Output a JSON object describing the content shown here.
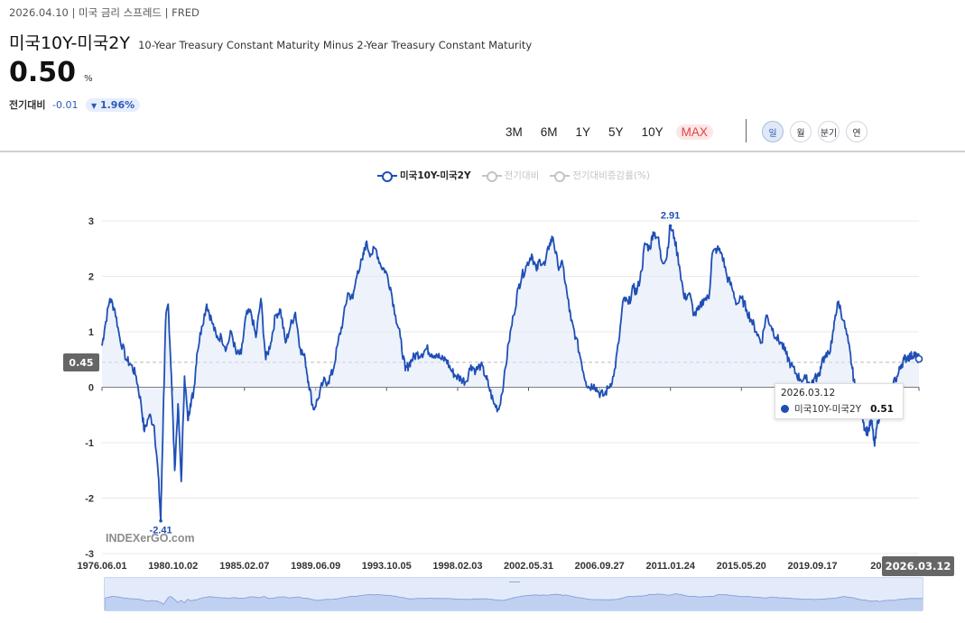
{
  "header": {
    "meta": "2026.04.10 | 미국 금리 스프레드 | FRED",
    "title": "미국10Y-미국2Y",
    "subtitle": "10-Year Treasury Constant Maturity Minus 2-Year Treasury Constant Maturity",
    "value": "0.50",
    "unit": "%",
    "change_label": "전기대비",
    "change_value": "-0.01",
    "change_pct": "1.96%"
  },
  "ranges": [
    "3M",
    "6M",
    "1Y",
    "5Y",
    "10Y",
    "MAX"
  ],
  "active_range": "MAX",
  "periods": [
    "일",
    "월",
    "분기",
    "연"
  ],
  "active_period": "일",
  "legend": [
    {
      "label": "미국10Y-미국2Y",
      "active": true
    },
    {
      "label": "전기대비",
      "active": false
    },
    {
      "label": "전기대비증감률(%)",
      "active": false
    }
  ],
  "watermark": "INDEXerGO.com",
  "tooltip": {
    "date": "2026.03.12",
    "series": "미국10Y-미국2Y",
    "value": "0.51"
  },
  "y_flag": "0.45",
  "x_flag": "2026.03.12",
  "colors": {
    "line": "#1f4fb5",
    "fill": "#dfe8f7",
    "grid": "#e8e8e8"
  },
  "chart_data": {
    "type": "area",
    "title": "",
    "xlabel": "",
    "ylabel": "",
    "ylim": [
      -3,
      3
    ],
    "yticks": [
      3,
      2,
      1,
      0,
      -1,
      -2,
      -3
    ],
    "xlim": [
      1976.42,
      2026.2
    ],
    "xtick_labels": [
      "1976.06.01",
      "1980.10.02",
      "1985.02.07",
      "1989.06.09",
      "1993.10.05",
      "1998.02.03",
      "2002.05.31",
      "2006.09.27",
      "2011.01.24",
      "2015.05.20",
      "2019.09.17",
      "2024.",
      "2026.03.12"
    ],
    "xtick_positions": [
      1976.42,
      1980.75,
      1985.1,
      1989.44,
      1993.76,
      1998.09,
      2002.41,
      2006.74,
      2011.06,
      2015.38,
      2019.71,
      2024.0,
      2026.2
    ],
    "annotations": [
      {
        "label": "2.91",
        "x": 2011.05,
        "y": 2.91
      },
      {
        "label": "-2.41",
        "x": 1980.0,
        "y": -2.41
      }
    ],
    "reference_line": 0.45,
    "series": [
      {
        "name": "미국10Y-미국2Y",
        "points": [
          [
            1976.42,
            0.75
          ],
          [
            1976.6,
            1.1
          ],
          [
            1976.9,
            1.6
          ],
          [
            1977.2,
            1.4
          ],
          [
            1977.5,
            0.9
          ],
          [
            1977.9,
            0.5
          ],
          [
            1978.2,
            0.4
          ],
          [
            1978.5,
            0.2
          ],
          [
            1978.8,
            -0.3
          ],
          [
            1979.0,
            -0.8
          ],
          [
            1979.3,
            -0.5
          ],
          [
            1979.6,
            -0.7
          ],
          [
            1979.85,
            -1.6
          ],
          [
            1980.0,
            -2.41
          ],
          [
            1980.15,
            -0.5
          ],
          [
            1980.3,
            1.2
          ],
          [
            1980.45,
            1.5
          ],
          [
            1980.65,
            0.2
          ],
          [
            1980.85,
            -1.5
          ],
          [
            1981.05,
            -0.3
          ],
          [
            1981.25,
            -1.7
          ],
          [
            1981.45,
            0.2
          ],
          [
            1981.65,
            -0.6
          ],
          [
            1981.8,
            -0.3
          ],
          [
            1982.0,
            -0.1
          ],
          [
            1982.2,
            0.6
          ],
          [
            1982.5,
            1.1
          ],
          [
            1982.8,
            1.5
          ],
          [
            1983.1,
            1.2
          ],
          [
            1983.4,
            0.9
          ],
          [
            1983.7,
            0.9
          ],
          [
            1984.0,
            0.7
          ],
          [
            1984.3,
            1.0
          ],
          [
            1984.6,
            0.6
          ],
          [
            1984.9,
            0.6
          ],
          [
            1985.2,
            1.3
          ],
          [
            1985.5,
            1.35
          ],
          [
            1985.8,
            0.9
          ],
          [
            1986.1,
            1.6
          ],
          [
            1986.4,
            0.5
          ],
          [
            1986.7,
            0.8
          ],
          [
            1987.0,
            1.3
          ],
          [
            1987.3,
            1.4
          ],
          [
            1987.6,
            0.8
          ],
          [
            1987.9,
            1.1
          ],
          [
            1988.2,
            1.35
          ],
          [
            1988.5,
            0.7
          ],
          [
            1988.8,
            0.5
          ],
          [
            1989.0,
            0.1
          ],
          [
            1989.3,
            -0.4
          ],
          [
            1989.6,
            -0.2
          ],
          [
            1989.9,
            0.1
          ],
          [
            1990.2,
            0.1
          ],
          [
            1990.5,
            0.3
          ],
          [
            1990.8,
            0.8
          ],
          [
            1991.1,
            1.2
          ],
          [
            1991.4,
            1.7
          ],
          [
            1991.7,
            1.6
          ],
          [
            1992.0,
            2.1
          ],
          [
            1992.3,
            2.3
          ],
          [
            1992.5,
            2.6
          ],
          [
            1992.8,
            2.4
          ],
          [
            1993.1,
            2.5
          ],
          [
            1993.4,
            2.2
          ],
          [
            1993.7,
            2.1
          ],
          [
            1994.0,
            1.8
          ],
          [
            1994.3,
            1.3
          ],
          [
            1994.6,
            0.9
          ],
          [
            1994.9,
            0.3
          ],
          [
            1995.1,
            0.4
          ],
          [
            1995.3,
            0.5
          ],
          [
            1995.6,
            0.6
          ],
          [
            1995.9,
            0.6
          ],
          [
            1996.2,
            0.7
          ],
          [
            1996.5,
            0.6
          ],
          [
            1996.8,
            0.6
          ],
          [
            1997.1,
            0.5
          ],
          [
            1997.4,
            0.5
          ],
          [
            1997.7,
            0.3
          ],
          [
            1998.0,
            0.2
          ],
          [
            1998.3,
            0.15
          ],
          [
            1998.6,
            0.1
          ],
          [
            1998.9,
            0.4
          ],
          [
            1999.2,
            0.3
          ],
          [
            1999.5,
            0.4
          ],
          [
            1999.8,
            0.2
          ],
          [
            2000.0,
            0.0
          ],
          [
            2000.3,
            -0.3
          ],
          [
            2000.6,
            -0.4
          ],
          [
            2000.9,
            0.1
          ],
          [
            2001.2,
            0.8
          ],
          [
            2001.5,
            1.3
          ],
          [
            2001.8,
            1.8
          ],
          [
            2002.0,
            2.0
          ],
          [
            2002.3,
            2.2
          ],
          [
            2002.6,
            2.4
          ],
          [
            2002.9,
            2.1
          ],
          [
            2003.1,
            2.3
          ],
          [
            2003.4,
            2.2
          ],
          [
            2003.7,
            2.6
          ],
          [
            2003.9,
            2.7
          ],
          [
            2004.2,
            2.2
          ],
          [
            2004.5,
            2.2
          ],
          [
            2004.8,
            1.6
          ],
          [
            2005.0,
            1.2
          ],
          [
            2005.3,
            0.9
          ],
          [
            2005.6,
            0.5
          ],
          [
            2005.9,
            0.1
          ],
          [
            2006.1,
            0.0
          ],
          [
            2006.4,
            0.05
          ],
          [
            2006.7,
            -0.1
          ],
          [
            2007.0,
            -0.15
          ],
          [
            2007.3,
            0.0
          ],
          [
            2007.6,
            0.2
          ],
          [
            2007.9,
            0.8
          ],
          [
            2008.2,
            1.6
          ],
          [
            2008.5,
            1.5
          ],
          [
            2008.8,
            1.8
          ],
          [
            2009.0,
            1.7
          ],
          [
            2009.3,
            2.1
          ],
          [
            2009.5,
            2.6
          ],
          [
            2009.8,
            2.5
          ],
          [
            2010.0,
            2.8
          ],
          [
            2010.3,
            2.7
          ],
          [
            2010.5,
            2.3
          ],
          [
            2010.8,
            2.3
          ],
          [
            2011.05,
            2.91
          ],
          [
            2011.3,
            2.7
          ],
          [
            2011.6,
            2.2
          ],
          [
            2011.9,
            1.6
          ],
          [
            2012.2,
            1.7
          ],
          [
            2012.5,
            1.3
          ],
          [
            2012.8,
            1.4
          ],
          [
            2013.1,
            1.6
          ],
          [
            2013.4,
            1.6
          ],
          [
            2013.6,
            2.4
          ],
          [
            2013.9,
            2.5
          ],
          [
            2014.2,
            2.4
          ],
          [
            2014.5,
            2.0
          ],
          [
            2014.8,
            1.8
          ],
          [
            2015.1,
            1.5
          ],
          [
            2015.4,
            1.6
          ],
          [
            2015.7,
            1.4
          ],
          [
            2016.0,
            1.2
          ],
          [
            2016.3,
            1.0
          ],
          [
            2016.6,
            0.8
          ],
          [
            2016.9,
            1.3
          ],
          [
            2017.2,
            1.1
          ],
          [
            2017.5,
            0.9
          ],
          [
            2017.8,
            0.8
          ],
          [
            2018.1,
            0.6
          ],
          [
            2018.4,
            0.4
          ],
          [
            2018.7,
            0.25
          ],
          [
            2018.95,
            0.15
          ],
          [
            2019.3,
            0.15
          ],
          [
            2019.6,
            0.05
          ],
          [
            2019.8,
            0.15
          ],
          [
            2020.1,
            0.2
          ],
          [
            2020.3,
            0.5
          ],
          [
            2020.6,
            0.55
          ],
          [
            2020.9,
            0.8
          ],
          [
            2021.1,
            1.3
          ],
          [
            2021.3,
            1.55
          ],
          [
            2021.6,
            1.2
          ],
          [
            2021.9,
            0.8
          ],
          [
            2022.1,
            0.4
          ],
          [
            2022.3,
            0.0
          ],
          [
            2022.5,
            -0.2
          ],
          [
            2022.7,
            -0.4
          ],
          [
            2022.9,
            -0.75
          ],
          [
            2023.1,
            -0.8
          ],
          [
            2023.3,
            -0.6
          ],
          [
            2023.5,
            -1.06
          ],
          [
            2023.7,
            -0.6
          ],
          [
            2023.9,
            -0.4
          ],
          [
            2024.1,
            -0.35
          ],
          [
            2024.4,
            -0.4
          ],
          [
            2024.65,
            0.1
          ],
          [
            2024.9,
            0.2
          ],
          [
            2025.1,
            0.4
          ],
          [
            2025.3,
            0.5
          ],
          [
            2025.5,
            0.55
          ],
          [
            2025.7,
            0.55
          ],
          [
            2025.9,
            0.62
          ],
          [
            2026.1,
            0.52
          ],
          [
            2026.2,
            0.51
          ]
        ]
      }
    ]
  }
}
